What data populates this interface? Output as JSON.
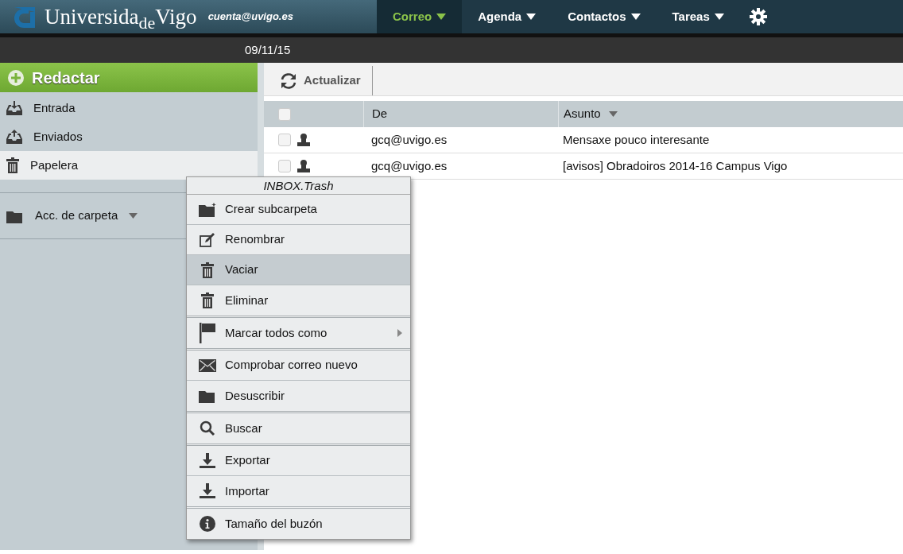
{
  "header": {
    "logo_main": "Universida",
    "logo_sub": "de",
    "logo_end": "Vigo",
    "account": "cuenta@uvigo.es",
    "nav": [
      {
        "label": "Correo",
        "selected": true
      },
      {
        "label": "Agenda",
        "selected": false
      },
      {
        "label": "Contactos",
        "selected": false
      },
      {
        "label": "Tareas",
        "selected": false
      }
    ]
  },
  "date": "09/11/15",
  "sidebar": {
    "compose": "Redactar",
    "folders": [
      {
        "label": "Entrada",
        "selected": false
      },
      {
        "label": "Enviados",
        "selected": false
      },
      {
        "label": "Papelera",
        "selected": true
      }
    ],
    "folder_actions": "Acc. de carpeta"
  },
  "toolbar": {
    "refresh": "Actualizar"
  },
  "table": {
    "select_all": {
      "checked": false
    },
    "columns": [
      "De",
      "Asunto"
    ],
    "rows": [
      {
        "checked": false,
        "from": "gcq@uvigo.es",
        "subject": "Mensaxe pouco interesante"
      },
      {
        "checked": false,
        "from": "gcq@uvigo.es",
        "subject": "[avisos] Obradoiros 2014-16 Campus Vigo"
      }
    ]
  },
  "context_menu": {
    "title": "INBOX.Trash",
    "groups": [
      [
        {
          "label": "Crear subcarpeta",
          "highlighted": false,
          "submenu": false
        },
        {
          "label": "Renombrar",
          "highlighted": false,
          "submenu": false
        },
        {
          "label": "Vaciar",
          "highlighted": true,
          "submenu": false
        },
        {
          "label": "Eliminar",
          "highlighted": false,
          "submenu": false
        }
      ],
      [
        {
          "label": "Marcar todos como",
          "highlighted": false,
          "submenu": true
        }
      ],
      [
        {
          "label": "Comprobar correo nuevo",
          "highlighted": false,
          "submenu": false
        },
        {
          "label": "Desuscribir",
          "highlighted": false,
          "submenu": false
        }
      ],
      [
        {
          "label": "Buscar",
          "highlighted": false,
          "submenu": false
        }
      ],
      [
        {
          "label": "Exportar",
          "highlighted": false,
          "submenu": false
        },
        {
          "label": "Importar",
          "highlighted": false,
          "submenu": false
        }
      ],
      [
        {
          "label": "Tamaño del buzón",
          "highlighted": false,
          "submenu": false
        }
      ]
    ]
  }
}
